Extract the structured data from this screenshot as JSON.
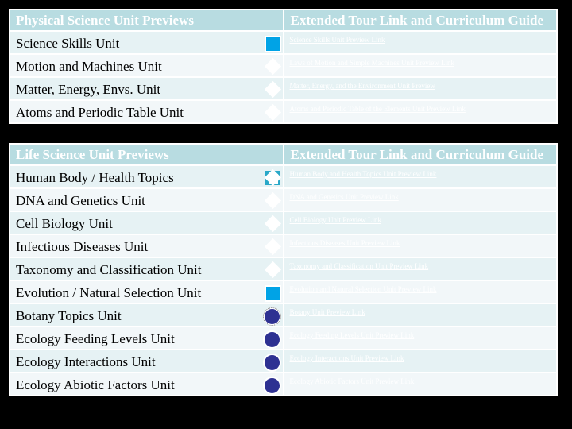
{
  "colors": {
    "header_bg": "#b8dce1",
    "row_odd_bg": "#e6f2f4",
    "row_even_bg": "#f2f7f9",
    "icon_light_blue": "#00a3e6",
    "icon_dark_blue": "#2e3192",
    "page_bg": "#000000"
  },
  "physical": {
    "header_col1": "Physical Science Unit Previews",
    "header_col2": "Extended Tour Link and Curriculum Guide",
    "rows": [
      {
        "unit": "Science Skills Unit",
        "icon": "square-icon",
        "link": "Science Skills Unit Preview Link"
      },
      {
        "unit": "Motion and Machines Unit",
        "icon": "diamond-icon",
        "link": "Laws of Motion and Simple Machines Unit Preview Link"
      },
      {
        "unit": "Matter, Energy, Envs. Unit",
        "icon": "diamond-icon",
        "link": "Matter, Energy, and the Environment Unit Preview"
      },
      {
        "unit": "Atoms and Periodic Table Unit",
        "icon": "diamond-icon",
        "link": "Atoms and Periodic Table of the Elements Unit Preview Link"
      }
    ]
  },
  "life": {
    "header_col1": "Life Science Unit Previews",
    "header_col2": "Extended Tour Link and Curriculum Guide",
    "rows": [
      {
        "unit": "Human Body / Health Topics",
        "icon": "diamond-icon",
        "link": "Human Body and Health Topics Unit Preview Link"
      },
      {
        "unit": "DNA and Genetics Unit",
        "icon": "diamond-icon",
        "link": "DNA and Genetics Unit Preview Link"
      },
      {
        "unit": "Cell Biology Unit",
        "icon": "diamond-icon",
        "link": "Cell Biology Unit Preview Link"
      },
      {
        "unit": "Infectious Diseases Unit",
        "icon": "diamond-icon",
        "link": "Infectious Diseases Unit Preview Link"
      },
      {
        "unit": "Taxonomy and Classification Unit",
        "icon": "diamond-icon",
        "link": "Taxonomy and Classification Unit Preview Link"
      },
      {
        "unit": "Evolution / Natural Selection Unit",
        "icon": "square-icon",
        "link": "Evolution and Natural Selection Unit Preview Link"
      },
      {
        "unit": "Botany Topics Unit",
        "icon": "circle-icon",
        "link": "Botany Unit Preview Link"
      },
      {
        "unit": "Ecology Feeding Levels Unit",
        "icon": "circle-icon",
        "link": "Ecology Feeding Levels Unit Preview Link"
      },
      {
        "unit": "Ecology Interactions Unit",
        "icon": "circle-icon",
        "link": "Ecology Interactions Unit Preview Link"
      },
      {
        "unit": "Ecology Abiotic Factors Unit",
        "icon": "circle-icon",
        "link": "Ecology Abiotic Factors Unit Preview Link"
      }
    ]
  }
}
